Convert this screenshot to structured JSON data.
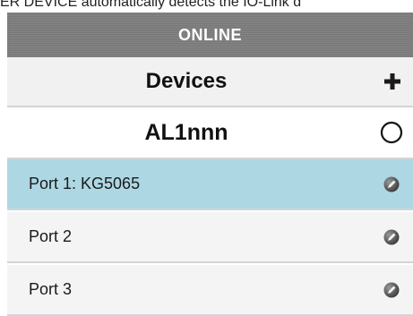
{
  "intro_text": "ER DEVICE automatically detects the IO-Link d",
  "header": {
    "status": "ONLINE"
  },
  "devices": {
    "title": "Devices",
    "add_icon": "plus-icon"
  },
  "device": {
    "name": "AL1nnn",
    "status_icon": "circle-icon"
  },
  "ports": [
    {
      "label": "Port 1: KG5065",
      "selected": true,
      "icon": "edit-icon"
    },
    {
      "label": "Port 2",
      "selected": false,
      "icon": "edit-icon"
    },
    {
      "label": "Port 3",
      "selected": false,
      "icon": "edit-icon"
    }
  ],
  "colors": {
    "header_bg": "#7d7d7d",
    "selected_row_bg": "#aed7e4",
    "row_bg": "#f4f4f4",
    "divider": "#d4d4d4"
  }
}
